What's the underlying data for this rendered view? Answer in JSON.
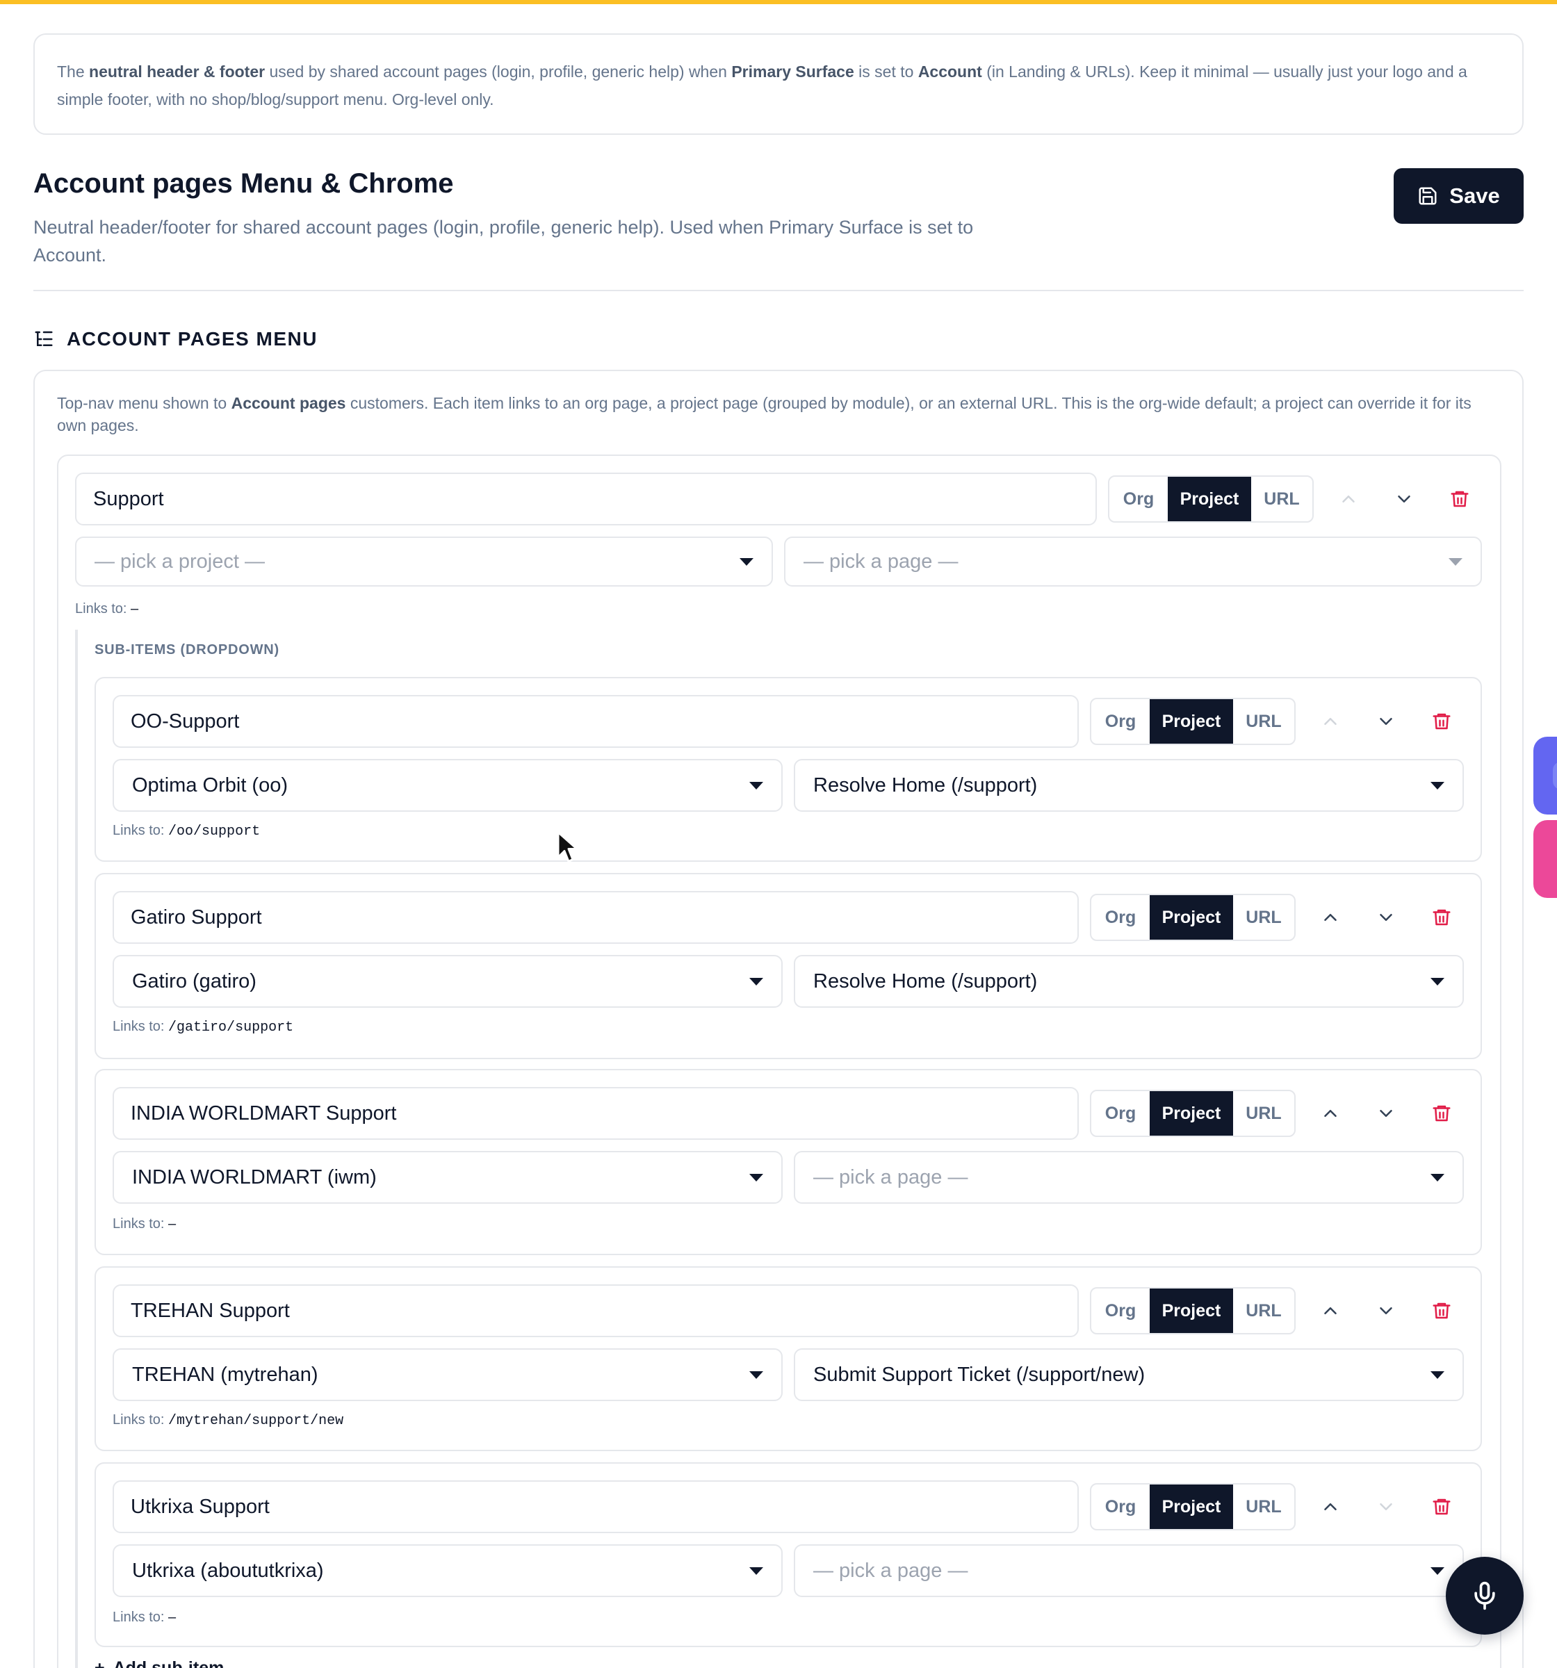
{
  "banner": {
    "t1": "The ",
    "b1": "neutral header & footer",
    "t2": " used by shared account pages (login, profile, generic help) when ",
    "b2": "Primary Surface",
    "t3": " is set to ",
    "b3": "Account",
    "t4": " (in Landing & URLs). Keep it minimal — usually just your logo and a simple footer, with no shop/blog/support menu. Org-level only."
  },
  "header": {
    "title": "Account pages Menu & Chrome",
    "subtitle": "Neutral header/footer for shared account pages (login, profile, generic help). Used when Primary Surface is set to Account.",
    "save_label": "Save"
  },
  "section": {
    "title": "ACCOUNT PAGES MENU",
    "desc_t1": "Top-nav menu shown to ",
    "desc_b1": "Account pages",
    "desc_t2": " customers. Each item links to an org page, a project page (grouped by module), or an external URL. This is the org-wide default; a project can override it for its own pages."
  },
  "segments": {
    "org": "Org",
    "project": "Project",
    "url": "URL"
  },
  "links_prefix": "Links to:",
  "top_item": {
    "label": "Support",
    "project_placeholder": "— pick a project —",
    "page_placeholder": "— pick a page —",
    "links_to": "–",
    "sub_items_label": "SUB-ITEMS (DROPDOWN)"
  },
  "sub_items": [
    {
      "label": "OO-Support",
      "project": "Optima Orbit (oo)",
      "page": "Resolve Home (/support)",
      "links_to": "/oo/support"
    },
    {
      "label": "Gatiro Support",
      "project": "Gatiro (gatiro)",
      "page": "Resolve Home (/support)",
      "links_to": "/gatiro/support"
    },
    {
      "label": "INDIA WORLDMART Support",
      "project": "INDIA WORLDMART (iwm)",
      "page": "— pick a page —",
      "links_to": "–"
    },
    {
      "label": "TREHAN Support",
      "project": "TREHAN (mytrehan)",
      "page": "Submit Support Ticket (/support/new)",
      "links_to": "/mytrehan/support/new"
    },
    {
      "label": "Utkrixa Support",
      "project": "Utkrixa (aboututkrixa)",
      "page": "— pick a page —",
      "links_to": "–"
    }
  ],
  "add_sub_item": "Add sub-item",
  "colors": {
    "accent_bar": "#fbbf24",
    "primary": "#0f172a",
    "danger": "#e11d48",
    "float_blue": "#6366f1",
    "float_pink": "#ec4899"
  }
}
